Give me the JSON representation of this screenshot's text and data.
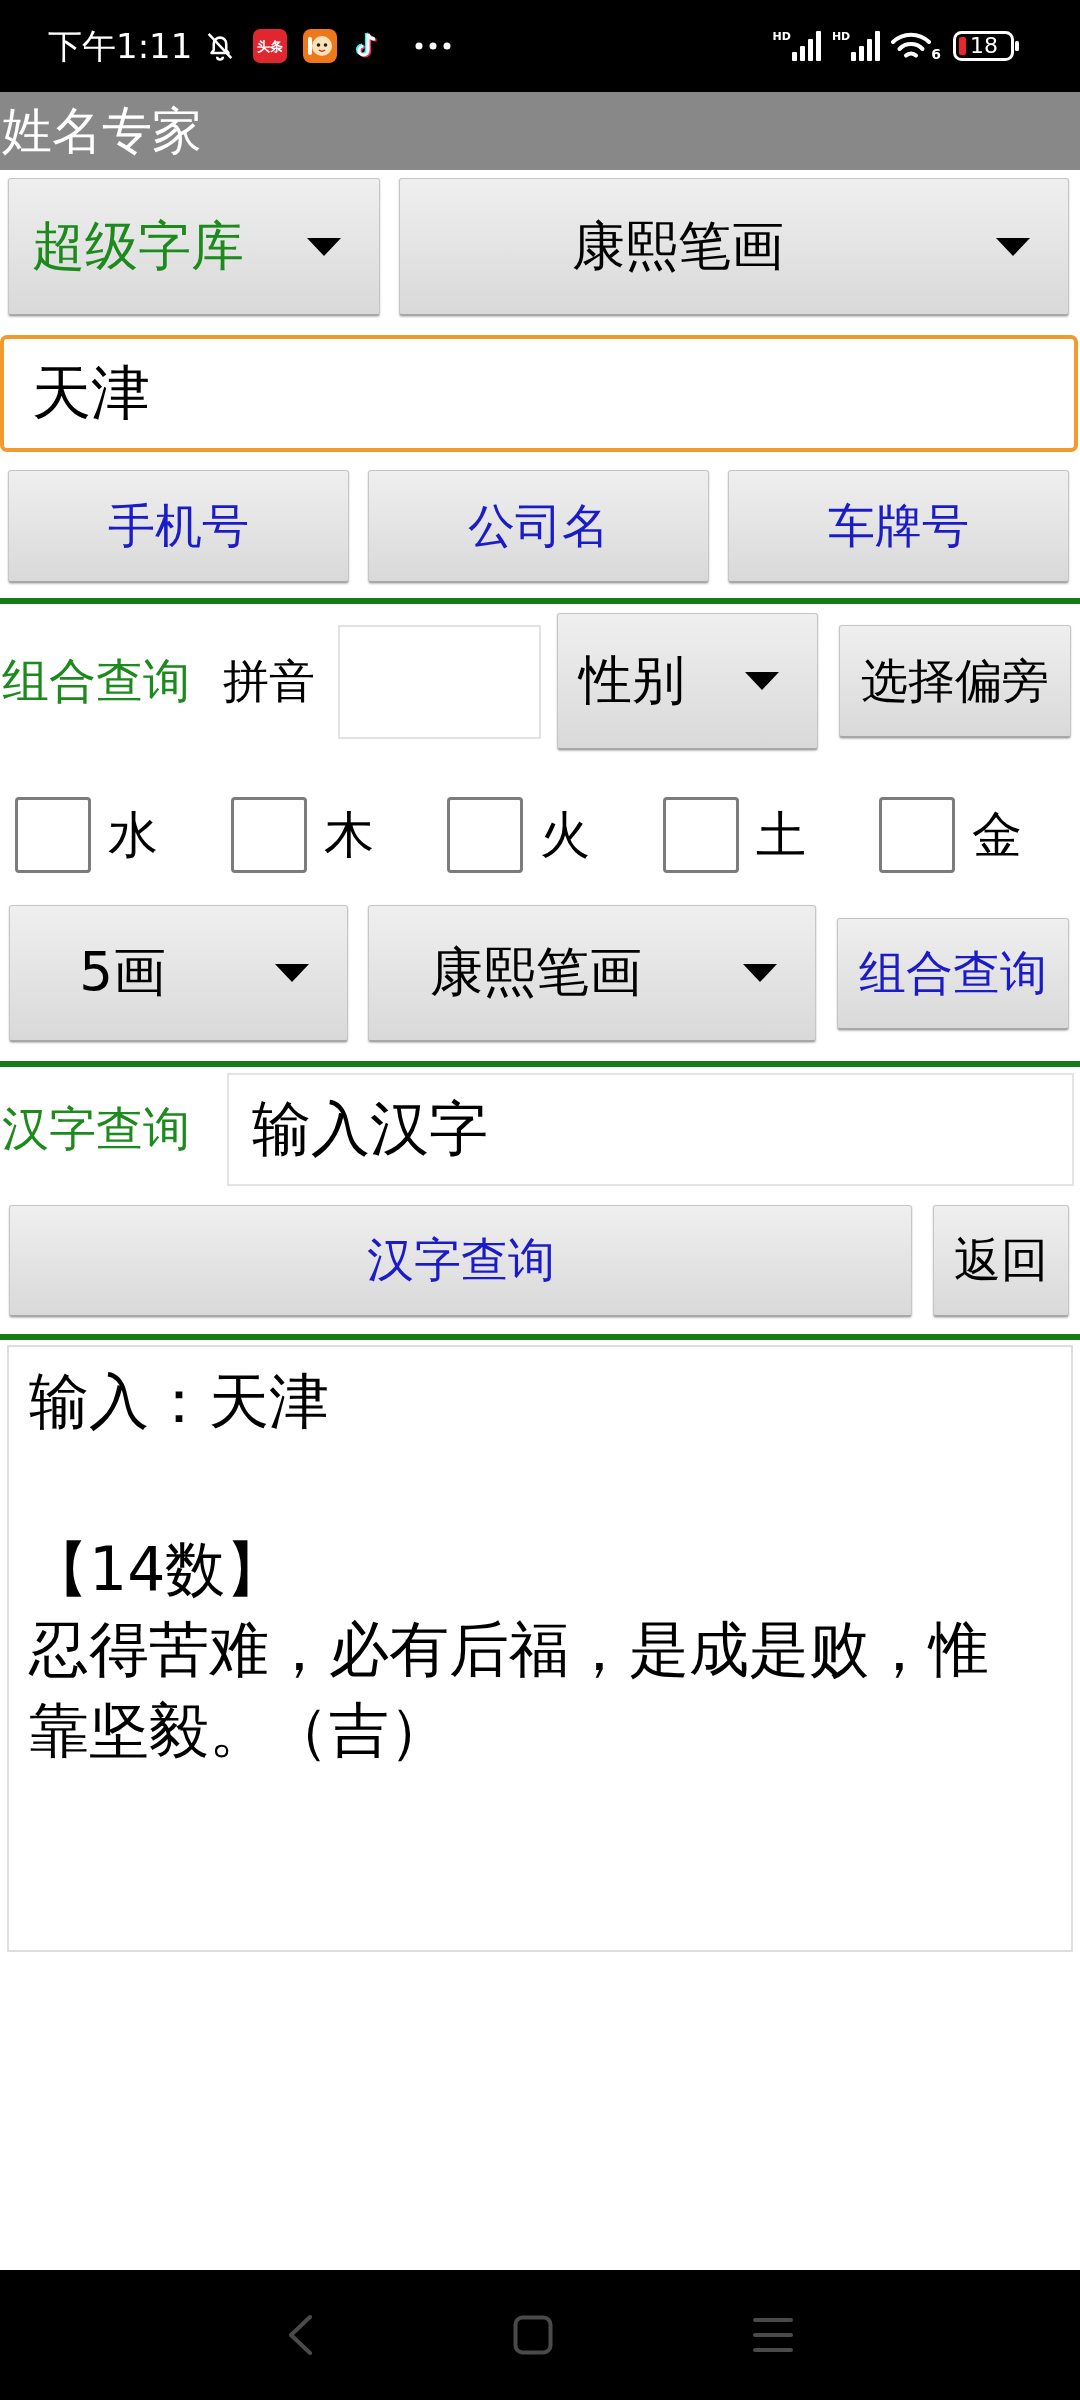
{
  "status_bar": {
    "time": "下午1:11",
    "news_app_label": "头条",
    "signals": [
      {
        "label": "HD"
      },
      {
        "label": "HD"
      }
    ],
    "wifi_label": "6",
    "battery": "18"
  },
  "app_bar": {
    "title": "姓名专家"
  },
  "top_dropdowns": [
    {
      "value": "超级字库"
    },
    {
      "value": "康熙笔画"
    }
  ],
  "name_field": {
    "value": "天津",
    "focused": true
  },
  "quick_buttons": [
    {
      "label": "手机号"
    },
    {
      "label": "公司名"
    },
    {
      "label": "车牌号"
    }
  ],
  "combo_query": {
    "label": "组合查询",
    "pinyin_label": "拼音",
    "gender_dropdown": "性别",
    "radical_button": "选择偏旁",
    "elements": [
      {
        "label": "水",
        "checked": false
      },
      {
        "label": "木",
        "checked": false
      },
      {
        "label": "火",
        "checked": false
      },
      {
        "label": "土",
        "checked": false
      },
      {
        "label": "金",
        "checked": false
      }
    ],
    "stroke_count_dropdown": "5画",
    "stroke_method_dropdown": "康熙笔画",
    "query_button": "组合查询"
  },
  "hanzi_query": {
    "label": "汉字查询",
    "field": {
      "value": "输入汉字"
    },
    "query_button": "汉字查询",
    "back_button": "返回"
  },
  "result": {
    "input_line": "输入：天津",
    "number_title": "【14数】",
    "description": "忍得苦难，必有后福，是成是败，惟靠坚毅。（吉）"
  }
}
